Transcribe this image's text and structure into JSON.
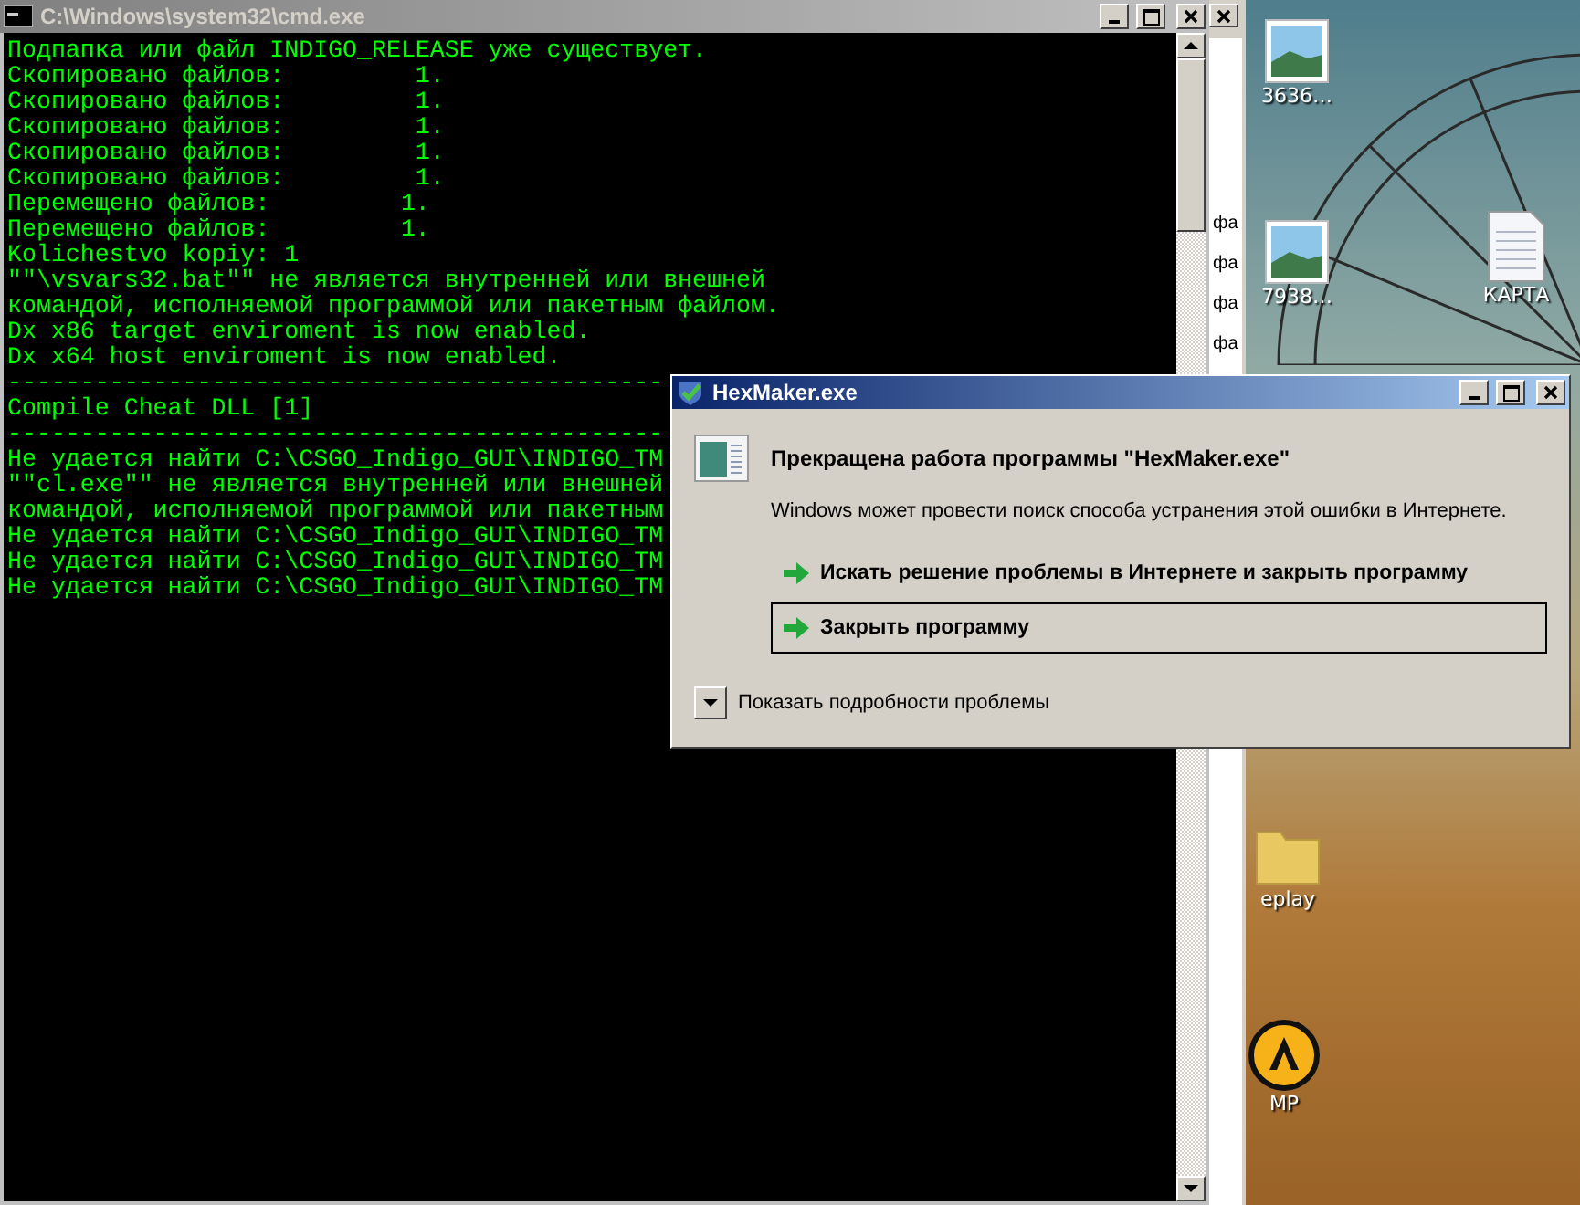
{
  "console_window": {
    "title": "C:\\Windows\\system32\\cmd.exe",
    "lines": [
      "Подпапка или файл INDIGO_RELEASE уже существует.",
      "Скопировано файлов:         1.",
      "Скопировано файлов:         1.",
      "Скопировано файлов:         1.",
      "Скопировано файлов:         1.",
      "Скопировано файлов:         1.",
      "Перемещено файлов:         1.",
      "Перемещено файлов:         1.",
      "Kolichestvo kopiy: 1",
      "\"\"\\vsvars32.bat\"\" не является внутренней или внешней",
      "командой, исполняемой программой или пакетным файлом.",
      "Dx x86 target enviroment is now enabled.",
      "Dx x64 host enviroment is now enabled.",
      "---------------------------------------------",
      "Compile Cheat DLL [1]",
      "---------------------------------------------",
      "Не удается найти C:\\CSGO_Indigo_GUI\\INDIGO_TM",
      "\"\"cl.exe\"\" не является внутренней или внешней",
      "командой, исполняемой программой или пакетным",
      "Не удается найти C:\\CSGO_Indigo_GUI\\INDIGO_TM",
      "Не удается найти C:\\CSGO_Indigo_GUI\\INDIGO_TM",
      "Не удается найти C:\\CSGO_Indigo_GUI\\INDIGO_TM"
    ]
  },
  "background_window": {
    "rows": [
      "фа",
      "фа",
      "фа",
      "фа"
    ]
  },
  "desktop_icons": [
    {
      "kind": "image",
      "label": "3636…"
    },
    {
      "kind": "image",
      "label": "7938…"
    },
    {
      "kind": "document",
      "label": "КАРТА"
    },
    {
      "kind": "folder",
      "label": "eplay"
    },
    {
      "kind": "app",
      "label": "MP"
    }
  ],
  "error_dialog": {
    "title": "HexMaker.exe",
    "heading": "Прекращена работа программы \"HexMaker.exe\"",
    "message": "Windows может провести поиск способа устранения этой ошибки в Интернете.",
    "options": [
      {
        "label": "Искать решение проблемы в Интернете и закрыть программу",
        "selected": false
      },
      {
        "label": "Закрыть программу",
        "selected": true
      }
    ],
    "details": {
      "label": "Показать подробности проблемы",
      "expanded": false
    }
  }
}
